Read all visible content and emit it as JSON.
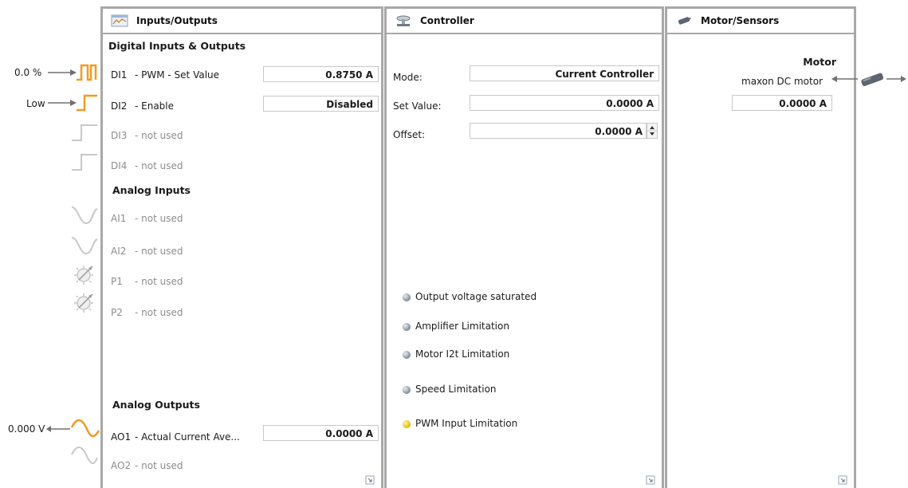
{
  "external": {
    "di1_value": "0.0 %",
    "di2_value": "Low",
    "ao1_value": "0.000 V"
  },
  "io_panel": {
    "title": "Inputs/Outputs",
    "digital_section": "Digital Inputs & Outputs",
    "di1": {
      "name": "DI1",
      "desc": "- PWM - Set Value",
      "value": "0.8750 A"
    },
    "di2": {
      "name": "DI2",
      "desc": "- Enable",
      "value": "Disabled"
    },
    "di3": {
      "name": "DI3",
      "desc": "- not used"
    },
    "di4": {
      "name": "DI4",
      "desc": "- not used"
    },
    "analog_inputs_section": "Analog Inputs",
    "ai1": {
      "name": "AI1",
      "desc": "- not used"
    },
    "ai2": {
      "name": "AI2",
      "desc": "- not used"
    },
    "p1": {
      "name": "P1",
      "desc": "- not used"
    },
    "p2": {
      "name": "P2",
      "desc": "- not used"
    },
    "analog_outputs_section": "Analog Outputs",
    "ao1": {
      "name": "AO1",
      "desc": "- Actual Current Ave...",
      "value": "0.0000 A"
    },
    "ao2": {
      "name": "AO2",
      "desc": "- not used"
    }
  },
  "controller_panel": {
    "title": "Controller",
    "mode_label": "Mode:",
    "mode_value": "Current Controller",
    "set_value_label": "Set Value:",
    "set_value": "0.0000 A",
    "offset_label": "Offset:",
    "offset_value": "0.0000 A",
    "indicators": [
      {
        "label": "Output voltage saturated",
        "state": "off"
      },
      {
        "label": "Amplifier Limitation",
        "state": "off"
      },
      {
        "label": "Motor I2t Limitation",
        "state": "off"
      },
      {
        "label": "Speed Limitation",
        "state": "off"
      },
      {
        "label": "PWM Input Limitation",
        "state": "on"
      }
    ]
  },
  "motor_panel": {
    "title": "Motor/Sensors",
    "motor_heading": "Motor",
    "motor_type": "maxon DC motor",
    "motor_value": "0.0000 A"
  },
  "colors": {
    "signal_active": "#f29a1f",
    "signal_inactive": "#c8c8c8",
    "panel_border": "#a8a8a8",
    "led_active": "#e2c000",
    "led_inactive": "#7a8a99"
  }
}
